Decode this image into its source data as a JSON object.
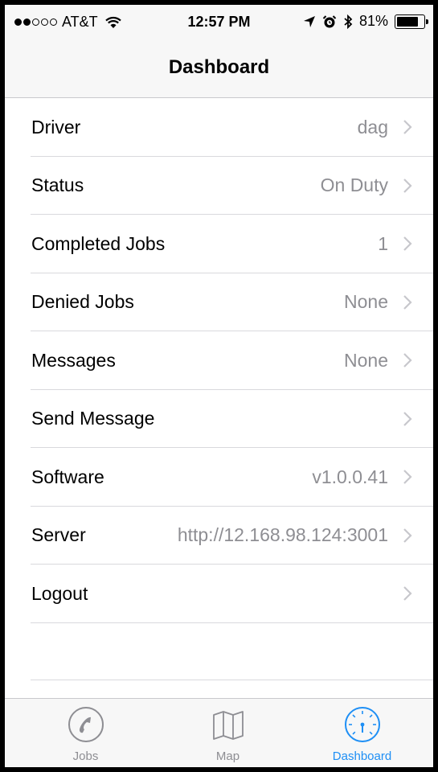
{
  "status_bar": {
    "carrier": "AT&T",
    "time": "12:57 PM",
    "battery": "81%",
    "battery_level": 0.81
  },
  "nav": {
    "title": "Dashboard"
  },
  "rows": [
    {
      "label": "Driver",
      "value": "dag"
    },
    {
      "label": "Status",
      "value": "On Duty"
    },
    {
      "label": "Completed Jobs",
      "value": "1"
    },
    {
      "label": "Denied Jobs",
      "value": "None"
    },
    {
      "label": "Messages",
      "value": "None"
    },
    {
      "label": "Send Message",
      "value": ""
    },
    {
      "label": "Software",
      "value": "v1.0.0.41"
    },
    {
      "label": "Server",
      "value": "http://12.168.98.124:3001"
    },
    {
      "label": "Logout",
      "value": ""
    }
  ],
  "tabs": [
    {
      "label": "Jobs",
      "icon": "phone-icon"
    },
    {
      "label": "Map",
      "icon": "map-icon"
    },
    {
      "label": "Dashboard",
      "icon": "gauge-icon",
      "active": true
    }
  ],
  "colors": {
    "accent": "#1e8ff5",
    "secondary_text": "#8e8e93",
    "separator": "#d9d9dd"
  }
}
